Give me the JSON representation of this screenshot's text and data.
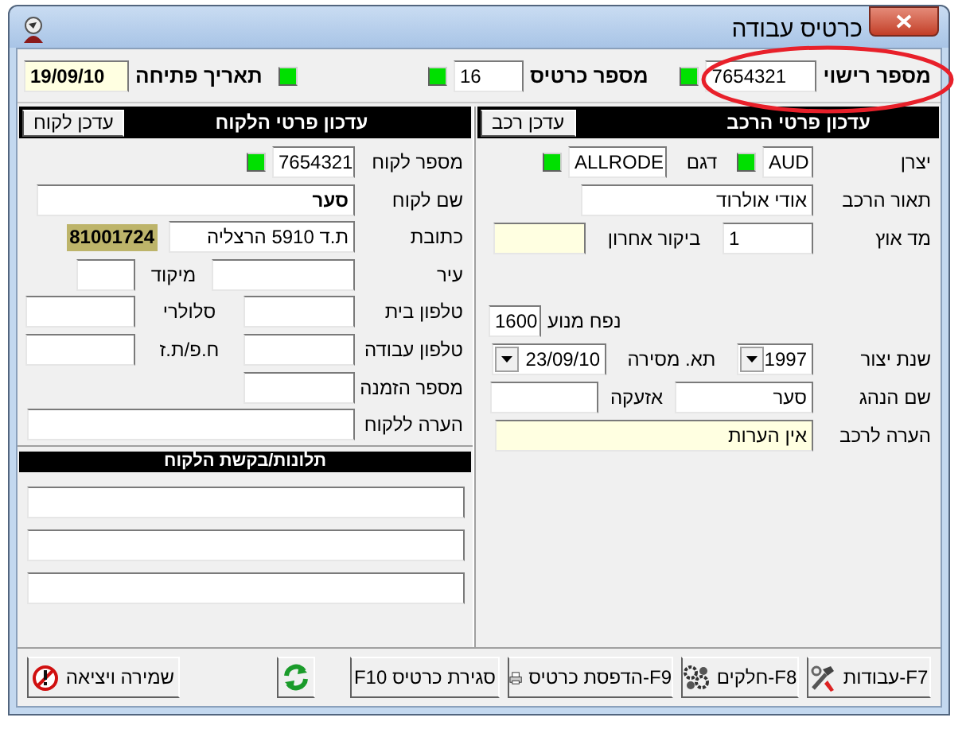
{
  "window": {
    "title": "כרטיס עבודה"
  },
  "header": {
    "fields": [
      {
        "label": "מספר רישוי",
        "value": "7654321",
        "light": true
      },
      {
        "label": "מספר כרטיס",
        "value": "16",
        "light": true
      },
      {
        "label": "תאריך פתיחה",
        "value": "19/09/10",
        "light": true
      }
    ]
  },
  "vehicle_panel": {
    "title": "עדכון פרטי הרכב",
    "button": "עדכן רכב",
    "rows": [
      [
        {
          "kind": "label",
          "text": "יצרן"
        },
        {
          "kind": "field",
          "value": "AUD",
          "light": true,
          "highlighted": false
        },
        {
          "kind": "label",
          "text": "דגם"
        },
        {
          "kind": "field",
          "value": "ALLRODE",
          "light": true,
          "highlighted": false
        }
      ],
      [
        {
          "kind": "label",
          "text": "תאור הרכב"
        },
        {
          "kind": "field",
          "value": "אודי אולרוד",
          "highlighted": false
        }
      ],
      [
        {
          "kind": "label",
          "text": "מד אוץ"
        },
        {
          "kind": "field",
          "value": "1",
          "highlighted": false
        },
        {
          "kind": "label",
          "text": "ביקור אחרון"
        },
        {
          "kind": "field",
          "highlighted": true
        }
      ],
      [
        {
          "kind": "empty"
        },
        {
          "kind": "empty"
        },
        {
          "kind": "label",
          "text": "נפח מנוע"
        },
        {
          "kind": "field",
          "value": "1600",
          "highlighted": false
        }
      ],
      [
        {
          "kind": "label",
          "text": "שנת יצור"
        },
        {
          "kind": "combo",
          "value": "1997"
        },
        {
          "kind": "label",
          "text": "תא. מסירה"
        },
        {
          "kind": "combo",
          "value": "23/09/10"
        }
      ],
      [
        {
          "kind": "label",
          "text": "שם הנהג"
        },
        {
          "kind": "field",
          "value": "סער",
          "highlighted": false
        },
        {
          "kind": "label",
          "text": "אזעקה"
        },
        {
          "kind": "field",
          "highlighted": false
        }
      ],
      [
        {
          "kind": "label",
          "text": "הערה לרכב"
        },
        {
          "kind": "field",
          "value": "אין הערות",
          "highlighted": true
        }
      ]
    ]
  },
  "customer_panel": {
    "title": "עדכון פרטי הלקוח",
    "button": "עדכן לקוח",
    "rows": [
      [
        {
          "kind": "label",
          "text": "מספר לקוח"
        },
        {
          "kind": "field",
          "value": "7654321",
          "light": true,
          "highlighted": false
        }
      ],
      [
        {
          "kind": "label",
          "text": "שם לקוח"
        },
        {
          "kind": "field",
          "value": "סער",
          "highlighted": false,
          "bold": true
        }
      ],
      [
        {
          "kind": "label",
          "text": "כתובת"
        },
        {
          "kind": "field",
          "value": "ת.ד 5910 הרצליה",
          "highlighted": false
        },
        {
          "kind": "badge",
          "text": "81001724"
        }
      ],
      [
        {
          "kind": "label",
          "text": "עיר"
        },
        {
          "kind": "field",
          "highlighted": false
        },
        {
          "kind": "label",
          "text": "מיקוד"
        },
        {
          "kind": "field",
          "highlighted": false
        }
      ],
      [
        {
          "kind": "label",
          "text": "טלפון בית"
        },
        {
          "kind": "field",
          "highlighted": false
        },
        {
          "kind": "label",
          "text": "סלולרי"
        },
        {
          "kind": "field",
          "highlighted": false
        }
      ],
      [
        {
          "kind": "label",
          "text": "טלפון עבודה"
        },
        {
          "kind": "field",
          "highlighted": false
        },
        {
          "kind": "label",
          "text": "ח.פ/ת.ז"
        },
        {
          "kind": "field",
          "highlighted": false
        }
      ],
      [
        {
          "kind": "label",
          "text": "מספר הזמנה"
        },
        {
          "kind": "field",
          "highlighted": false
        }
      ],
      [
        {
          "kind": "label",
          "text": "הערה ללקוח"
        },
        {
          "kind": "field",
          "highlighted": false
        }
      ]
    ]
  },
  "complaints": {
    "title": "תלונות/בקשת הלקוח",
    "fields": [
      {
        "highlighted": false
      },
      {
        "highlighted": false
      },
      {
        "highlighted": false
      }
    ]
  },
  "buttons": [
    {
      "kind": "button",
      "label": "F7-עבודות"
    },
    {
      "kind": "button",
      "label": "F8-חלקים"
    },
    {
      "kind": "button",
      "label": "F9-הדפסת כרטיס"
    },
    {
      "kind": "button",
      "label": "סגירת כרטיס F10"
    },
    {
      "kind": "icon-button"
    },
    {
      "kind": "button",
      "label": "שמירה ויציאה"
    }
  ]
}
